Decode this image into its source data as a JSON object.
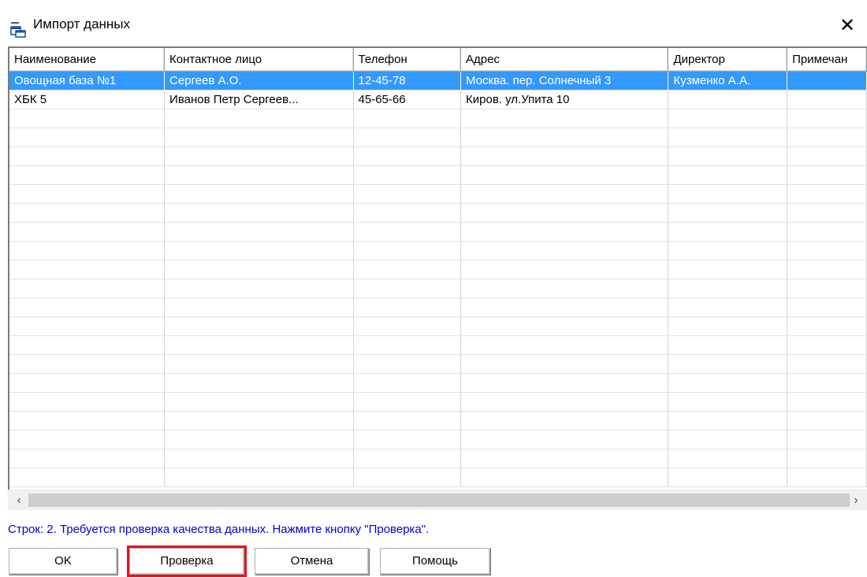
{
  "window": {
    "title": "Импорт данных",
    "close_symbol": "✕",
    "icon": "table-import-icon"
  },
  "grid": {
    "columns": [
      "Наименование",
      "Контактное лицо",
      "Телефон",
      "Адрес",
      "Директор",
      "Примечан"
    ],
    "rows": [
      [
        "Овощная база №1",
        "Сергеев А.О.",
        "12-45-78",
        "Москва. пер. Солнечный 3",
        "Кузменко А.А.",
        ""
      ],
      [
        "ХБК 5",
        "Иванов Петр Сергеев...",
        "45-65-66",
        "Киров. ул.Упита 10",
        "",
        ""
      ]
    ],
    "selected_row": 0
  },
  "scrollbar": {
    "left_arrow": "‹",
    "right_arrow": "›"
  },
  "status": "Строк: 2. Требуется проверка качества данных. Нажмите кнопку \"Проверка\".",
  "buttons": {
    "ok": "OK",
    "check": "Проверка",
    "cancel": "Отмена",
    "help": "Помощь"
  },
  "colors": {
    "selection": "#3399ff",
    "status_text": "#0000d0",
    "highlight_outline": "#e0151b"
  }
}
